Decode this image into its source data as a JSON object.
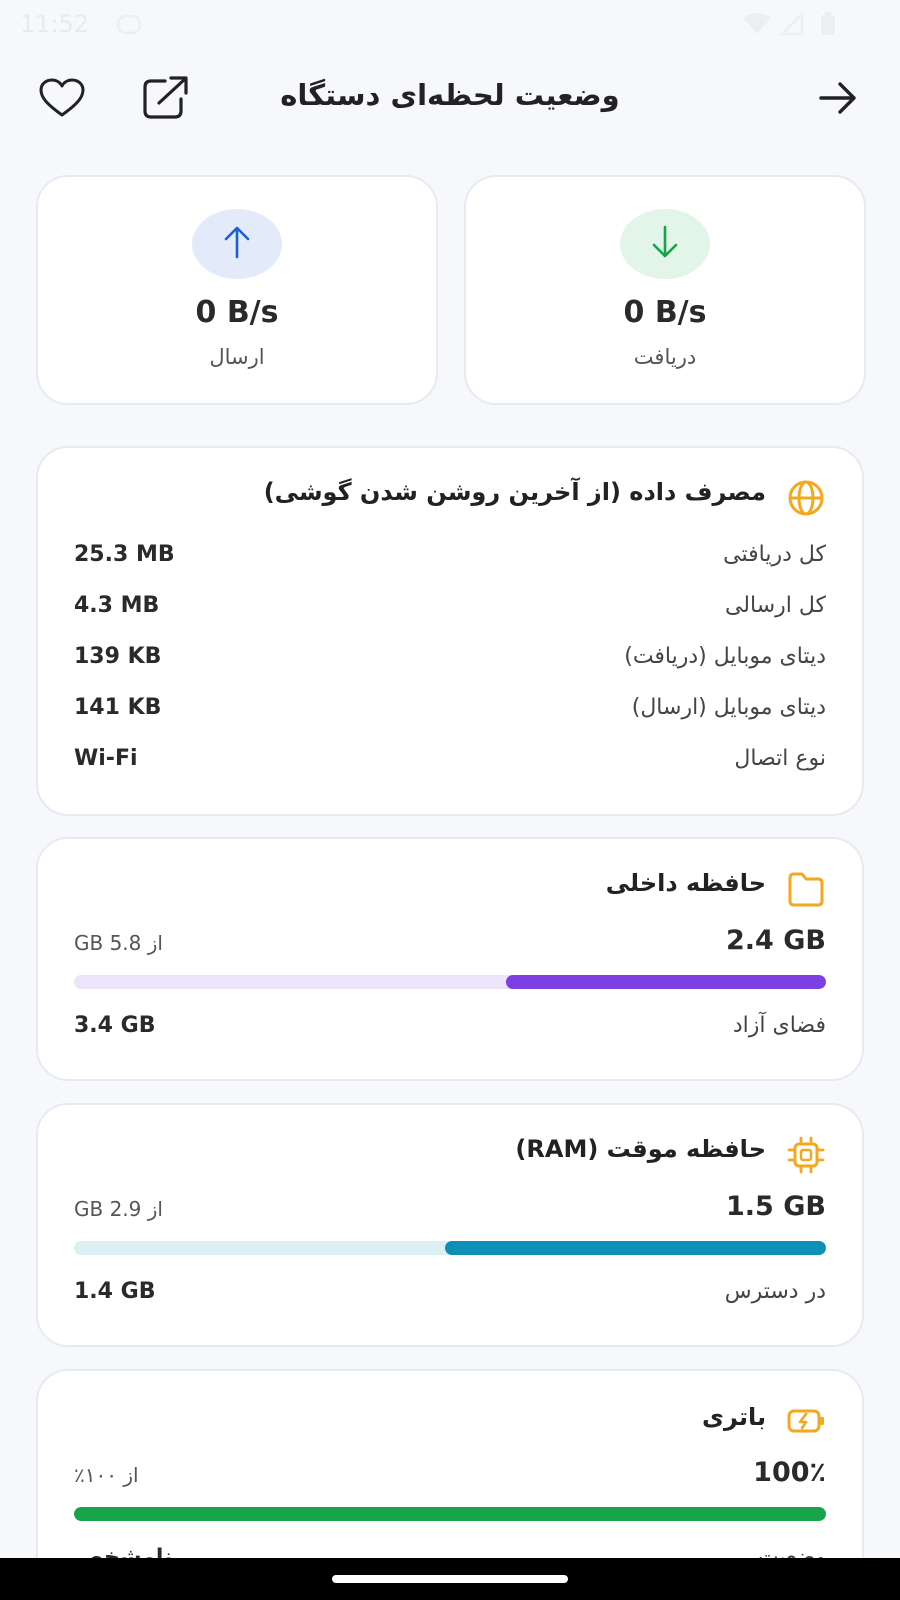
{
  "status_bar": {
    "time": "11:52"
  },
  "header": {
    "title": "وضعیت لحظه‌ای دستگاه"
  },
  "speeds": {
    "download": {
      "value": "0 B/s",
      "label": "دریافت"
    },
    "upload": {
      "value": "0 B/s",
      "label": "ارسال"
    }
  },
  "data_usage": {
    "title": "مصرف داده (از آخرین روشن شدن گوشی)",
    "rows": [
      {
        "label": "کل دریافتی",
        "value": "25.3 MB"
      },
      {
        "label": "کل ارسالی",
        "value": "4.3 MB"
      },
      {
        "label": "دیتای موبایل (دریافت)",
        "value": "139 KB"
      },
      {
        "label": "دیتای موبایل (ارسال)",
        "value": "141 KB"
      },
      {
        "label": "نوع اتصال",
        "value": "Wi-Fi"
      }
    ]
  },
  "storage": {
    "title": "حافظه داخلی",
    "used": "2.4 GB",
    "total": "از 5.8 GB",
    "used_fraction": 0.425,
    "free_label": "فضای آزاد",
    "free_value": "3.4 GB"
  },
  "ram": {
    "title": "حافظه موقت (RAM)",
    "used": "1.5 GB",
    "total": "از 2.9 GB",
    "used_fraction": 0.507,
    "available_label": "در دسترس",
    "available_value": "1.4 GB"
  },
  "battery": {
    "title": "باتری",
    "level": "100٪",
    "of": "از ۱۰۰٪",
    "level_fraction": 1.0,
    "status_label": "وضعیت",
    "status_value": "نامشخص"
  },
  "colors": {
    "upload_accent": "#1a5fd6",
    "download_accent": "#17a34a",
    "storage_accent": "#7b3fe4",
    "ram_accent": "#0e8fb5",
    "battery_accent": "#16a34a",
    "icon_accent": "#f4a81d"
  }
}
